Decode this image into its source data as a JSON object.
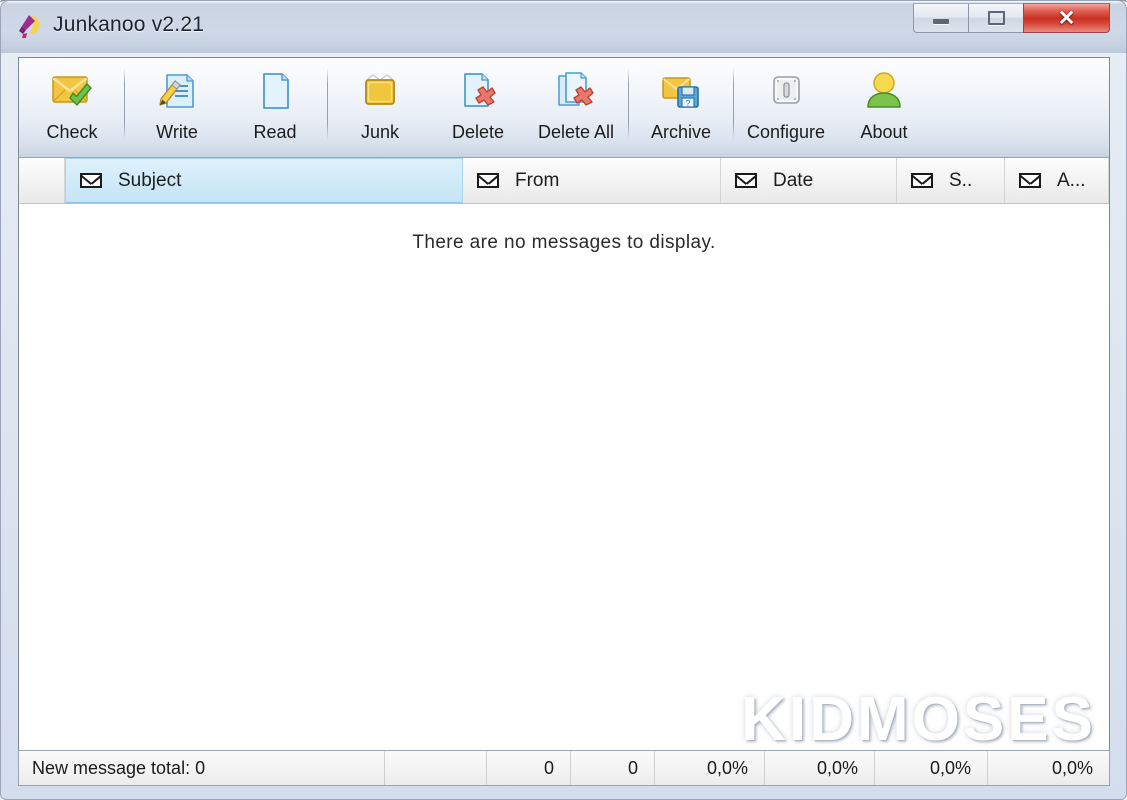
{
  "window": {
    "title": "Junkanoo v2.21",
    "app_icon": "junkanoo-logo-icon",
    "controls": {
      "minimize": "minimize-icon",
      "maximize": "maximize-icon",
      "close": "✕"
    }
  },
  "toolbar": {
    "items": [
      {
        "label": "Check",
        "icon": "envelope-check-icon"
      },
      {
        "label": "Write",
        "icon": "document-pencil-icon"
      },
      {
        "label": "Read",
        "icon": "blank-page-icon"
      },
      {
        "label": "Junk",
        "icon": "junk-box-icon"
      },
      {
        "label": "Delete",
        "icon": "page-delete-icon"
      },
      {
        "label": "Delete All",
        "icon": "pages-delete-all-icon"
      },
      {
        "label": "Archive",
        "icon": "envelope-save-icon"
      },
      {
        "label": "Configure",
        "icon": "configure-panel-icon"
      },
      {
        "label": "About",
        "icon": "user-about-icon"
      }
    ]
  },
  "columns": [
    {
      "label": "Subject",
      "icon": "envelope-icon",
      "selected": true
    },
    {
      "label": "From",
      "icon": "envelope-icon",
      "selected": false
    },
    {
      "label": "Date",
      "icon": "envelope-icon",
      "selected": false
    },
    {
      "label": "S..",
      "icon": "envelope-icon",
      "selected": false
    },
    {
      "label": "A...",
      "icon": "envelope-icon",
      "selected": false
    }
  ],
  "list": {
    "empty_message": "There are no messages to display.",
    "watermark": "KIDMOSES"
  },
  "statusbar": {
    "cells": [
      {
        "text": "New message total: 0",
        "align": "left"
      },
      {
        "text": "",
        "align": "left"
      },
      {
        "text": "0",
        "align": "right"
      },
      {
        "text": "0",
        "align": "right"
      },
      {
        "text": "0,0%",
        "align": "right"
      },
      {
        "text": "0,0%",
        "align": "right"
      },
      {
        "text": "0,0%",
        "align": "right"
      },
      {
        "text": "0,0%",
        "align": "right"
      }
    ]
  },
  "colors": {
    "titlebar": "#ccd6e4",
    "close_button": "#c92f22",
    "selected_column": "#cfeaf8",
    "frame": "#d4dded"
  }
}
